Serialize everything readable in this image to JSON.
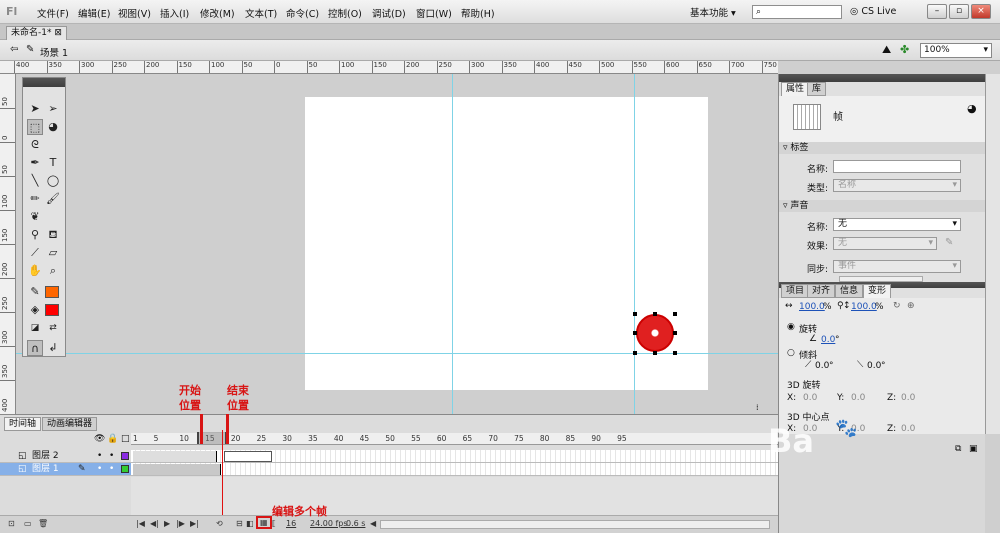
{
  "app": {
    "logo": "Fl"
  },
  "menu": [
    "文件(F)",
    "编辑(E)",
    "视图(V)",
    "插入(I)",
    "修改(M)",
    "文本(T)",
    "命令(C)",
    "控制(O)",
    "调试(D)",
    "窗口(W)",
    "帮助(H)"
  ],
  "workspace": "基本功能 ▾",
  "search": {
    "placeholder": ""
  },
  "cslive": "CS Live",
  "window_buttons": [
    "–",
    "▫",
    "×"
  ],
  "doc_tab": "未命名-1* ⊠",
  "scene": "场景 1",
  "zoom": "100%",
  "hruler_labels": [
    "400",
    "350",
    "300",
    "250",
    "200",
    "150",
    "100",
    "50",
    "0",
    "50",
    "100",
    "150",
    "200",
    "250",
    "300",
    "350",
    "400",
    "450",
    "500",
    "550",
    "600",
    "650",
    "700",
    "750",
    "800"
  ],
  "vruler_labels": [
    "50",
    "0",
    "50",
    "100",
    "150",
    "200",
    "250",
    "300",
    "350",
    "400"
  ],
  "properties": {
    "tabs": [
      "属性",
      "库"
    ],
    "title": "帧",
    "label_section": "标签",
    "name_label": "名称:",
    "type_label": "类型:",
    "type_value": "名称",
    "sound_section": "声音",
    "sound_name_label": "名称:",
    "sound_name_value": "无",
    "effect_label": "效果:",
    "effect_value": "无",
    "sync_label": "同步:",
    "sync_value": "事件"
  },
  "transform": {
    "tabs": [
      "项目",
      "对齐",
      "信息",
      "变形"
    ],
    "w_pct": "100.0",
    "h_pct": "100.0",
    "pct": "%",
    "rotate": "旋转",
    "rotate_val": "0.0",
    "deg": "°",
    "skew": "倾斜",
    "skew_val1": "0.0",
    "skew_val2": "0.0",
    "rot3d": "3D 旋转",
    "x_label": "X:",
    "y_label": "Y:",
    "z_label": "Z:",
    "x_val": "0.0",
    "y_val": "0.0",
    "z_val": "0.0",
    "center3d": "3D 中心点",
    "cx_val": "0.0",
    "cy_val": "0.0",
    "cz_val": "0.0"
  },
  "timeline": {
    "tabs": [
      "时间轴",
      "动画编辑器"
    ],
    "frame_numbers": [
      "1",
      "5",
      "10",
      "15",
      "20",
      "25",
      "30",
      "35",
      "40",
      "45",
      "50",
      "55",
      "60",
      "65",
      "70",
      "75",
      "80",
      "85",
      "90",
      "95"
    ],
    "layers": [
      {
        "name": "图层 2",
        "color": "#8a2be2"
      },
      {
        "name": "图层 1",
        "color": "#33cc33"
      }
    ],
    "current_frame": "16",
    "fps": "24.00 fps",
    "time": "0.6 s"
  },
  "annotations": {
    "start": "开始\n位置",
    "end": "结束\n位置",
    "edit_multi": "编辑多个帧"
  },
  "tools_colors": {
    "stroke": "#ff6600",
    "fill": "#ff0000"
  },
  "watermark": "Ba"
}
